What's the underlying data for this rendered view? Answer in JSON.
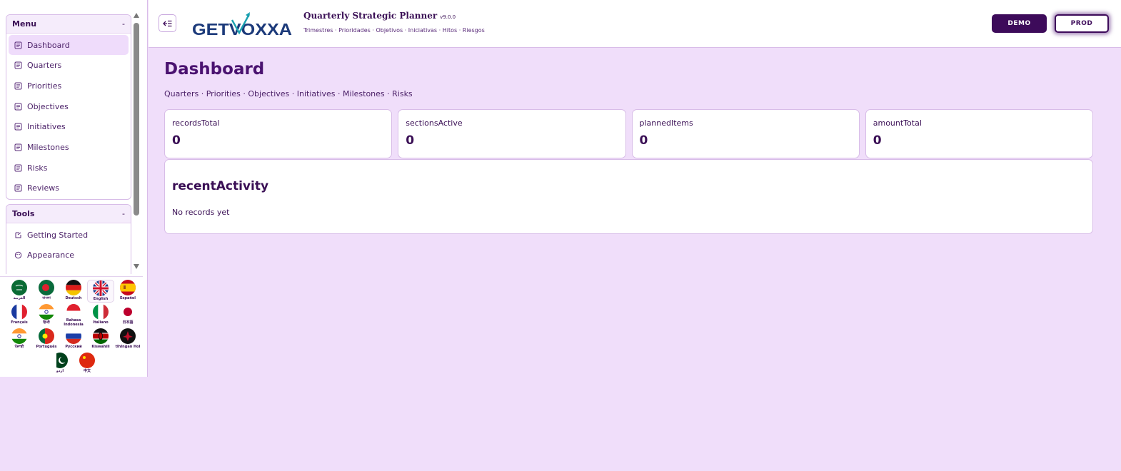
{
  "colors": {
    "accent": "#3d0b5a",
    "background": "#f0defa",
    "active_item": "#efdcfb"
  },
  "header": {
    "logo_text": "GETVOXXA",
    "title": "Quarterly Strategic Planner",
    "version": "v9.0.0",
    "subtitle": "Trimestres · Prioridades · Objetivos · Iniciativas · Hitos · Riesgos",
    "env_buttons": {
      "demo": "DEMO",
      "prod": "PROD"
    },
    "collapse_icon": "sidebar-collapse-icon"
  },
  "sidebar": {
    "menu": {
      "title": "Menu",
      "toggle": "-",
      "items": [
        {
          "label": "Dashboard",
          "icon": "document-icon",
          "active": true
        },
        {
          "label": "Quarters",
          "icon": "document-icon"
        },
        {
          "label": "Priorities",
          "icon": "document-icon"
        },
        {
          "label": "Objectives",
          "icon": "document-icon"
        },
        {
          "label": "Initiatives",
          "icon": "document-icon"
        },
        {
          "label": "Milestones",
          "icon": "document-icon"
        },
        {
          "label": "Risks",
          "icon": "document-icon"
        },
        {
          "label": "Reviews",
          "icon": "document-icon"
        }
      ]
    },
    "tools": {
      "title": "Tools",
      "toggle": "-",
      "items": [
        {
          "label": "Getting Started",
          "icon": "launch-icon"
        },
        {
          "label": "Appearance",
          "icon": "palette-icon"
        }
      ]
    },
    "languages": [
      {
        "label": "العربية",
        "flag": "saudi-flag-icon"
      },
      {
        "label": "বাংলা",
        "flag": "bangladesh-flag-icon"
      },
      {
        "label": "Deutsch",
        "flag": "germany-flag-icon"
      },
      {
        "label": "English",
        "flag": "uk-flag-icon",
        "selected": true
      },
      {
        "label": "Español",
        "flag": "spain-flag-icon"
      },
      {
        "label": "Français",
        "flag": "france-flag-icon"
      },
      {
        "label": "हिन्दी",
        "flag": "india-flag-icon"
      },
      {
        "label": "Bahasa Indonesia",
        "flag": "indonesia-flag-icon"
      },
      {
        "label": "Italiano",
        "flag": "italy-flag-icon"
      },
      {
        "label": "日本語",
        "flag": "japan-flag-icon"
      },
      {
        "label": "ਪੰਜਾਬੀ",
        "flag": "india-flag-icon"
      },
      {
        "label": "Português",
        "flag": "portugal-flag-icon"
      },
      {
        "label": "Русский",
        "flag": "russia-flag-icon"
      },
      {
        "label": "Kiswahili",
        "flag": "kenya-flag-icon"
      },
      {
        "label": "tlhIngan Hol",
        "flag": "klingon-flag-icon"
      },
      {
        "label": "اردو",
        "flag": "pakistan-flag-icon"
      },
      {
        "label": "中文",
        "flag": "china-flag-icon"
      }
    ]
  },
  "main": {
    "title": "Dashboard",
    "breadcrumb": "Quarters · Priorities · Objectives · Initiatives · Milestones · Risks",
    "stats": [
      {
        "label": "recordsTotal",
        "value": "0"
      },
      {
        "label": "sectionsActive",
        "value": "0"
      },
      {
        "label": "plannedItems",
        "value": "0"
      },
      {
        "label": "amountTotal",
        "value": "0"
      }
    ],
    "recent": {
      "title": "recentActivity",
      "empty": "No records yet"
    }
  }
}
